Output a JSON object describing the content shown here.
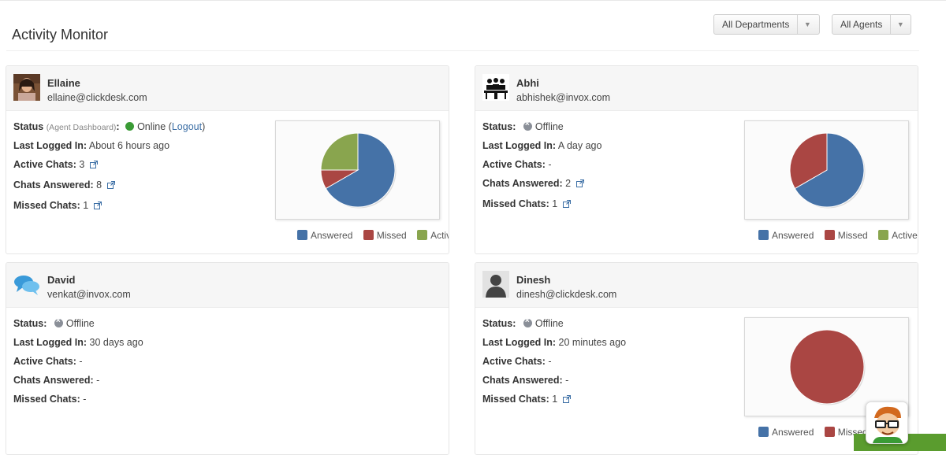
{
  "header": {
    "title": "Activity Monitor",
    "filters": [
      {
        "label": "All Departments"
      },
      {
        "label": "All Agents"
      }
    ]
  },
  "labels": {
    "status": "Status",
    "agent_dashboard": "(Agent Dashboard)",
    "last_logged_in": "Last Logged In:",
    "active_chats": "Active Chats:",
    "chats_answered": "Chats Answered:",
    "missed_chats": "Missed Chats:",
    "logout": "Logout"
  },
  "legend": {
    "answered": "Answered",
    "missed": "Missed",
    "active": "Active"
  },
  "colors": {
    "answered": "#4572a7",
    "missed": "#aa4643",
    "active": "#89a54e",
    "online": "#3a9b35"
  },
  "agents": [
    {
      "name": "Ellaine",
      "email": "ellaine@clickdesk.com",
      "avatar": "photo-avatar",
      "status": "Online",
      "last_logged_in": "About 6 hours ago",
      "active_chats": "3",
      "chats_answered": "8",
      "missed_chats": "1"
    },
    {
      "name": "Abhi",
      "email": "abhishek@invox.com",
      "avatar": "people-at-desk-avatar",
      "status": "Offline",
      "last_logged_in": "A day ago",
      "active_chats": "-",
      "chats_answered": "2",
      "missed_chats": "1"
    },
    {
      "name": "David",
      "email": "venkat@invox.com",
      "avatar": "chat-bubbles-avatar",
      "status": "Offline",
      "last_logged_in": "30 days ago",
      "active_chats": "-",
      "chats_answered": "-",
      "missed_chats": "-"
    },
    {
      "name": "Dinesh",
      "email": "dinesh@clickdesk.com",
      "avatar": "default-person-avatar",
      "status": "Offline",
      "last_logged_in": "20 minutes ago",
      "active_chats": "-",
      "chats_answered": "-",
      "missed_chats": "1"
    }
  ],
  "chart_data": [
    {
      "type": "pie",
      "categories": [
        "Answered",
        "Missed",
        "Active"
      ],
      "values": [
        8,
        1,
        3
      ]
    },
    {
      "type": "pie",
      "categories": [
        "Answered",
        "Missed",
        "Active"
      ],
      "values": [
        2,
        1,
        0
      ]
    },
    {
      "type": "pie",
      "categories": [
        "Answered",
        "Missed",
        "Active"
      ],
      "values": [
        0,
        1,
        0
      ]
    }
  ]
}
